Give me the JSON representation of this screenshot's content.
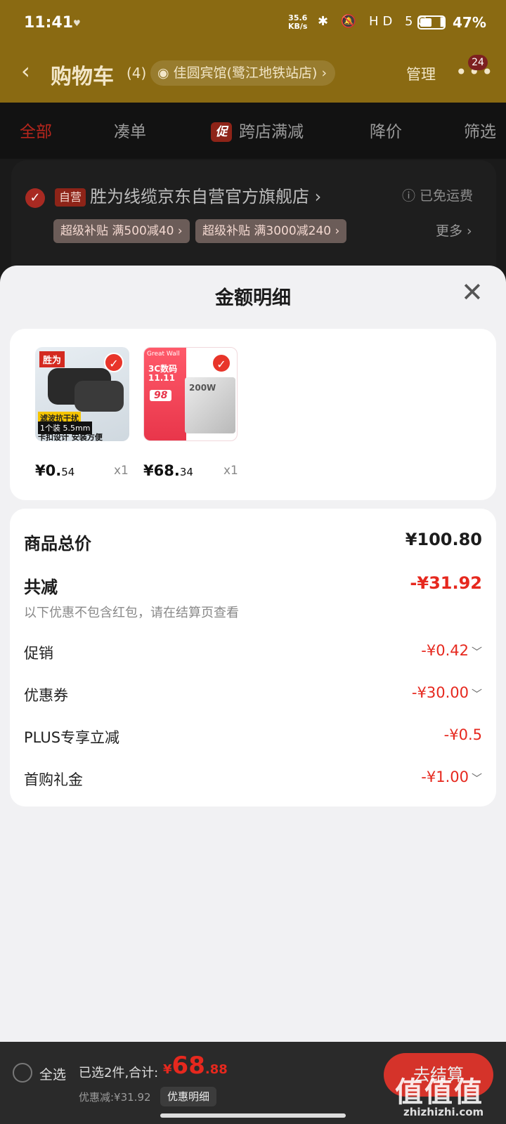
{
  "status": {
    "time": "11:41",
    "net_speed": "35.6",
    "net_unit": "KB/s",
    "icons": "✱ 🔕 HD 5G ▮",
    "battery": "47%"
  },
  "header": {
    "back": "‹",
    "title": "购物车",
    "count": "(4)",
    "address": "佳圆宾馆(鹭江地铁站店)",
    "manage": "管理",
    "more": "•••",
    "badge": "24"
  },
  "tabs": {
    "all": "全部",
    "combine": "凑单",
    "promo_tag": "促",
    "cross_store": "跨店满减",
    "price_drop": "降价",
    "filter": "筛选"
  },
  "store": {
    "tag": "自营",
    "name": "胜为线缆京东自营官方旗舰店 ›",
    "shipping": "ⓘ 已免运费",
    "promo1": "超级补贴  满500减40 ›",
    "promo2": "超级补贴  满3000减240 ›",
    "more": "更多 ›"
  },
  "sheet": {
    "title": "金额明细",
    "close": "✕",
    "items": [
      {
        "price_int": "¥0.",
        "price_dec": "54",
        "qty": "x1",
        "img": {
          "brand": "胜为",
          "line1": "滤波抗干扰",
          "line2": "1个装  5.5mm",
          "line3": "卡扣设计 安装方便"
        }
      },
      {
        "price_int": "¥68.",
        "price_dec": "34",
        "qty": "x1",
        "img": {
          "brand": "Great Wall",
          "line1": "3C数码",
          "line2": "11.11",
          "tag": "98",
          "model": "200W"
        }
      }
    ],
    "total_label": "商品总价",
    "total_value": "¥100.80",
    "discount_label": "共减",
    "discount_value": "-¥31.92",
    "discount_note": "以下优惠不包含红包，请在结算页查看",
    "lines": [
      {
        "label": "促销",
        "value": "-¥0.42",
        "chevron": "﹀"
      },
      {
        "label": "优惠券",
        "value": "-¥30.00",
        "chevron": "﹀"
      },
      {
        "label": "PLUS专享立减",
        "value": "-¥0.5",
        "chevron": ""
      },
      {
        "label": "首购礼金",
        "value": "-¥1.00",
        "chevron": "﹀"
      }
    ]
  },
  "bottom": {
    "select_all": "全选",
    "selected": "已选2件,合计:",
    "currency": "¥",
    "total_int": "68",
    "total_dec": ".88",
    "saved": "优惠减:¥31.92",
    "detail_btn": "优惠明细",
    "pay": "去结算"
  },
  "watermark": {
    "logo": "值值值",
    "site": "zhizhizhi.com"
  }
}
